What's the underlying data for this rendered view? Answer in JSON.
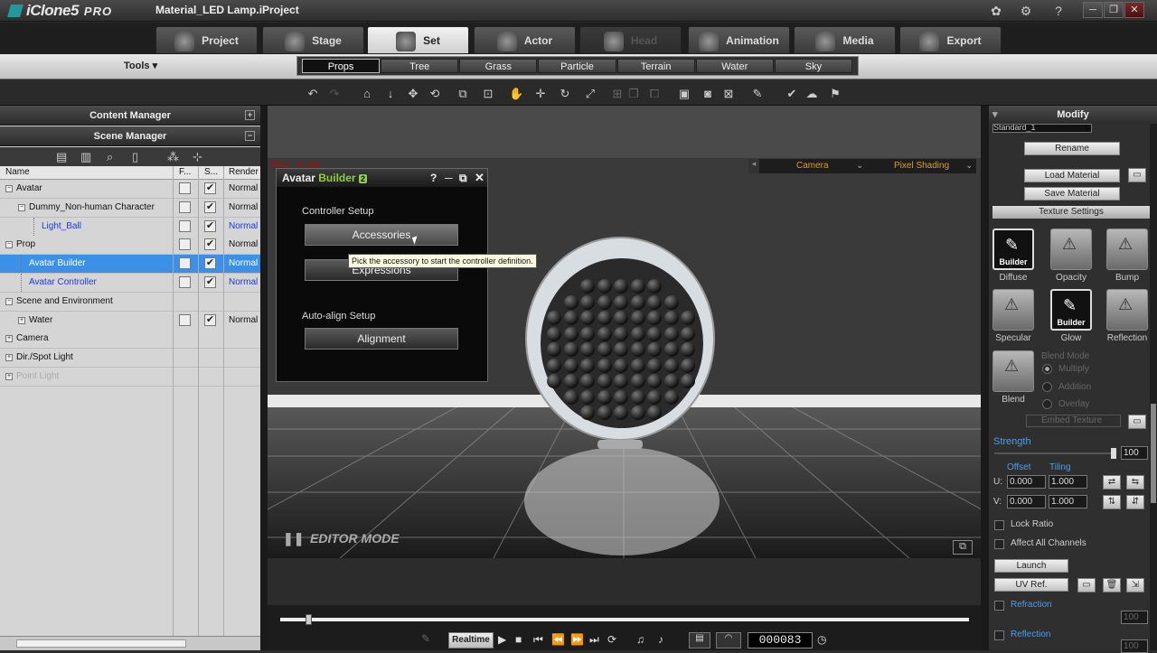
{
  "app": {
    "name": "iClone",
    "version": "5",
    "edition": "PRO",
    "project": "Material_LED Lamp.iProject"
  },
  "window_controls": {
    "minimize": "─",
    "restore": "❐",
    "close": "✕"
  },
  "main_tabs": [
    {
      "label": "Project",
      "icon": "project-icon",
      "state": "normal"
    },
    {
      "label": "Stage",
      "icon": "stage-icon",
      "state": "normal"
    },
    {
      "label": "Set",
      "icon": "set-icon",
      "state": "active"
    },
    {
      "label": "Actor",
      "icon": "actor-icon",
      "state": "normal"
    },
    {
      "label": "Head",
      "icon": "head-icon",
      "state": "disabled"
    },
    {
      "label": "Animation",
      "icon": "animation-icon",
      "state": "normal"
    },
    {
      "label": "Media",
      "icon": "media-icon",
      "state": "normal"
    },
    {
      "label": "Export",
      "icon": "export-icon",
      "state": "normal"
    }
  ],
  "tools_menu": "Tools ▾",
  "sub_tabs": [
    {
      "label": "Props",
      "active": true
    },
    {
      "label": "Tree",
      "active": false
    },
    {
      "label": "Grass",
      "active": false
    },
    {
      "label": "Particle",
      "active": false
    },
    {
      "label": "Terrain",
      "active": false
    },
    {
      "label": "Water",
      "active": false
    },
    {
      "label": "Sky",
      "active": false
    }
  ],
  "left_panel": {
    "content_manager": "Content Manager",
    "scene_manager": "Scene Manager",
    "columns": [
      "Name",
      "F...",
      "S...",
      "Render"
    ],
    "rows": [
      {
        "name": "Avatar",
        "level": 0,
        "expander": "−",
        "freeze": "",
        "show": "✔",
        "render": "Normal",
        "color": "black",
        "selected": false
      },
      {
        "name": "Dummy_Non-human Character",
        "level": 1,
        "expander": "−",
        "freeze": "",
        "show": "✔",
        "render": "Normal",
        "color": "black",
        "selected": false
      },
      {
        "name": "Light_Ball",
        "level": 2,
        "expander": "",
        "freeze": "",
        "show": "✔",
        "render": "Normal",
        "color": "blue",
        "selected": false
      },
      {
        "name": "Prop",
        "level": 0,
        "expander": "−",
        "freeze": "",
        "show": "✔",
        "render": "Normal",
        "color": "black",
        "selected": false
      },
      {
        "name": "Avatar Builder",
        "level": 1,
        "expander": "",
        "freeze": "",
        "show": "✔",
        "render": "Normal",
        "color": "white",
        "selected": true
      },
      {
        "name": "Avatar Controller",
        "level": 1,
        "expander": "",
        "freeze": "",
        "show": "✔",
        "render": "Normal",
        "color": "blue",
        "selected": false
      },
      {
        "name": "Scene and Environment",
        "level": 0,
        "expander": "−",
        "freeze": "",
        "show": "",
        "render": "",
        "color": "black",
        "selected": false
      },
      {
        "name": "Water",
        "level": 1,
        "expander": "+",
        "freeze": "",
        "show": "✔",
        "render": "Normal",
        "color": "black",
        "selected": false
      },
      {
        "name": "Camera",
        "level": 0,
        "expander": "+",
        "freeze": "",
        "show": "",
        "render": "",
        "color": "black",
        "selected": false
      },
      {
        "name": "Dir./Spot Light",
        "level": 0,
        "expander": "+",
        "freeze": "",
        "show": "",
        "render": "",
        "color": "black",
        "selected": false
      },
      {
        "name": "Point Light",
        "level": 0,
        "expander": "+",
        "freeze": "",
        "show": "",
        "render": "",
        "color": "faded",
        "selected": false
      }
    ]
  },
  "viewport": {
    "fps": "FPS: 0.00",
    "camera_label": "Camera",
    "shading_label": "Pixel Shading",
    "editor_mode": "EDITOR MODE"
  },
  "avatar_builder": {
    "title_main": "Avatar ",
    "title_accent": "Builder",
    "title_badge": "2",
    "controller_setup": "Controller Setup",
    "accessories": "Accessories",
    "expressions": "Expressions",
    "auto_align_setup": "Auto-align Setup",
    "alignment": "Alignment",
    "tooltip": "Pick the accessory to start the controller definition."
  },
  "timeline": {
    "realtime": "Realtime",
    "frame": "000083"
  },
  "modify_panel": {
    "title": "Modify",
    "material_name": "Standard_1",
    "rename": "Rename",
    "load_material": "Load Material",
    "save_material": "Save Material",
    "texture_settings": "Texture Settings",
    "channels": [
      {
        "label": "Diffuse",
        "badge": "Builder",
        "active": true
      },
      {
        "label": "Opacity",
        "badge": "",
        "active": false
      },
      {
        "label": "Bump",
        "badge": "",
        "active": false
      },
      {
        "label": "Specular",
        "badge": "",
        "active": false
      },
      {
        "label": "Glow",
        "badge": "Builder",
        "active": true
      },
      {
        "label": "Reflection",
        "badge": "",
        "active": false
      },
      {
        "label": "Blend",
        "badge": "",
        "active": false
      }
    ],
    "blend_mode": "Blend Mode",
    "blend_options": [
      "Multiply",
      "Addition",
      "Overlay"
    ],
    "embed_texture": "Embed Texture",
    "strength": "Strength",
    "strength_value": "100",
    "offset": "Offset",
    "tiling": "Tiling",
    "u_label": "U:",
    "v_label": "V:",
    "u_offset": "0.000",
    "u_tiling": "1.000",
    "v_offset": "0.000",
    "v_tiling": "1.000",
    "lock_ratio": "Lock Ratio",
    "affect_all": "Affect All Channels",
    "launch": "Launch",
    "uv_ref": "UV Ref.",
    "refraction": "Refraction",
    "refraction_value": "100",
    "reflection": "Reflection",
    "reflection_value": "100"
  }
}
